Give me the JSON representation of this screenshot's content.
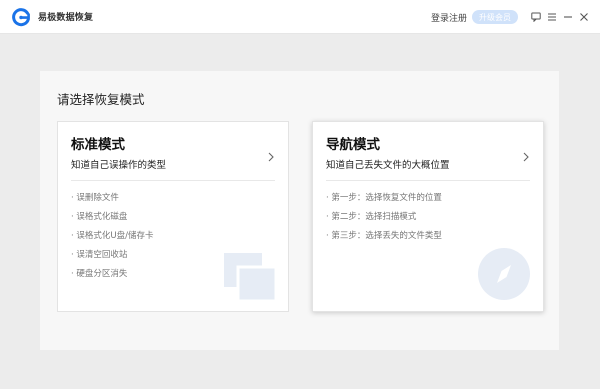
{
  "app": {
    "title": "易极数据恢复"
  },
  "titlebar": {
    "login_label": "登录注册",
    "upgrade_label": "升级会员",
    "icons": [
      "feedback-icon",
      "menu-icon",
      "minimize-icon",
      "close-icon"
    ]
  },
  "panel": {
    "title": "请选择恢复模式"
  },
  "cards": [
    {
      "title": "标准模式",
      "subtitle": "知道自己误操作的类型",
      "items": [
        "· 误删除文件",
        "· 误格式化磁盘",
        "· 误格式化U盘/储存卡",
        "· 误清空回收站",
        "· 硬盘分区消失"
      ]
    },
    {
      "title": "导航模式",
      "subtitle": "知道自己丢失文件的大概位置",
      "items": [
        "· 第一步：选择恢复文件的位置",
        "· 第二步：选择扫描模式",
        "· 第三步：选择丢失的文件类型"
      ]
    }
  ],
  "colors": {
    "accent": "#1a73e8",
    "upgrade_bg": "#d0e2fa",
    "watermark": "#e6ecf5"
  }
}
